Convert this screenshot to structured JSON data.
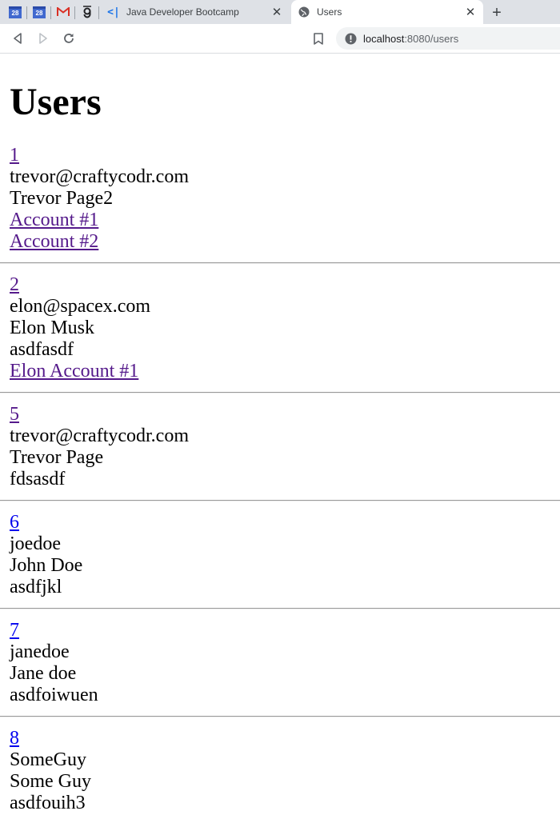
{
  "browser": {
    "pinned_tabs": [
      {
        "icon": "calendar-icon",
        "label": "28"
      },
      {
        "icon": "calendar-icon",
        "label": "28"
      },
      {
        "icon": "gmail-icon"
      },
      {
        "icon": "g-icon"
      }
    ],
    "tabs": [
      {
        "icon": "code-bracket-icon",
        "title": "Java Developer Bootcamp",
        "active": false
      },
      {
        "icon": "globe-icon",
        "title": "Users",
        "active": true
      }
    ],
    "address": {
      "host": "localhost",
      "path": ":8080/users"
    }
  },
  "page": {
    "heading": "Users",
    "users": [
      {
        "id": "1",
        "username": "trevor@craftycodr.com",
        "name": "Trevor Page2",
        "password": "",
        "accounts": [
          "Account #1",
          "Account #2"
        ]
      },
      {
        "id": "2",
        "username": "elon@spacex.com",
        "name": "Elon Musk",
        "password": "asdfasdf",
        "accounts": [
          "Elon Account #1"
        ]
      },
      {
        "id": "5",
        "username": "trevor@craftycodr.com",
        "name": "Trevor Page",
        "password": "fdsasdf",
        "accounts": []
      },
      {
        "id": "6",
        "username": "joedoe",
        "name": "John Doe",
        "password": "asdfjkl",
        "accounts": []
      },
      {
        "id": "7",
        "username": "janedoe",
        "name": "Jane doe",
        "password": "asdfoiwuen",
        "accounts": []
      },
      {
        "id": "8",
        "username": "SomeGuy",
        "name": "Some Guy",
        "password": "asdfouih3",
        "accounts": []
      }
    ]
  },
  "colors": {
    "link_visited": "#551a8b",
    "link_unvisited": "#0000ee",
    "tabstrip": "#dee1e6"
  }
}
